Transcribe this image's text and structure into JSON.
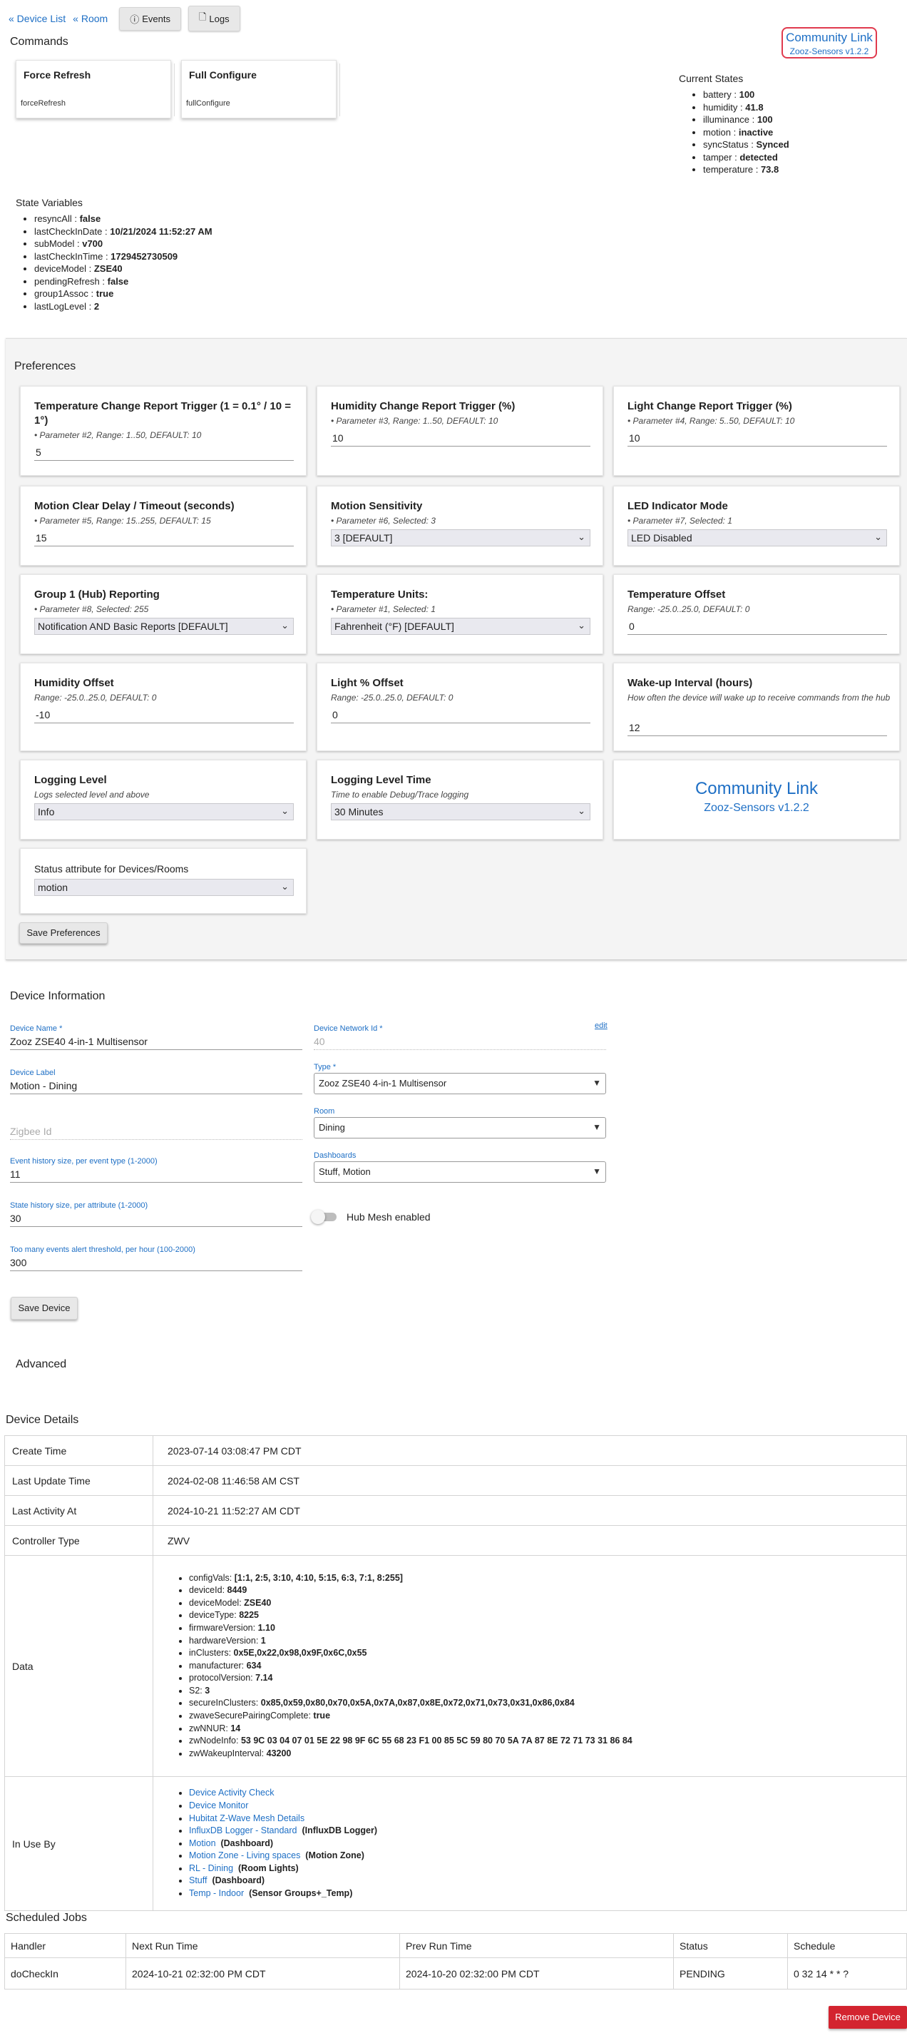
{
  "nav": {
    "device_list": "« Device List",
    "room": "« Room",
    "events": "Events",
    "logs": "Logs"
  },
  "community_top": {
    "title": "Community Link",
    "version": "Zooz-Sensors v1.2.2"
  },
  "commands": {
    "heading": "Commands",
    "items": [
      {
        "title": "Force Refresh",
        "method": "forceRefresh"
      },
      {
        "title": "Full Configure",
        "method": "fullConfigure"
      }
    ]
  },
  "current_states": {
    "heading": "Current States",
    "items": [
      {
        "key": "battery",
        "value": "100"
      },
      {
        "key": "humidity",
        "value": "41.8"
      },
      {
        "key": "illuminance",
        "value": "100"
      },
      {
        "key": "motion",
        "value": "inactive"
      },
      {
        "key": "syncStatus",
        "value": "Synced"
      },
      {
        "key": "tamper",
        "value": "detected"
      },
      {
        "key": "temperature",
        "value": "73.8"
      }
    ]
  },
  "state_variables": {
    "heading": "State Variables",
    "items": [
      {
        "key": "resyncAll",
        "value": "false"
      },
      {
        "key": "lastCheckInDate",
        "value": "10/21/2024 11:52:27 AM"
      },
      {
        "key": "subModel",
        "value": "v700"
      },
      {
        "key": "lastCheckInTime",
        "value": "1729452730509"
      },
      {
        "key": "deviceModel",
        "value": "ZSE40"
      },
      {
        "key": "pendingRefresh",
        "value": "false"
      },
      {
        "key": "group1Assoc",
        "value": "true"
      },
      {
        "key": "lastLogLevel",
        "value": "2"
      }
    ]
  },
  "preferences": {
    "heading": "Preferences",
    "temp_trigger": {
      "title": "Temperature Change Report Trigger (1 = 0.1° / 10 = 1°)",
      "desc": "• Parameter #2, Range: 1..50, DEFAULT: 10",
      "value": "5"
    },
    "humidity_trigger": {
      "title": "Humidity Change Report Trigger (%)",
      "desc": "• Parameter #3, Range: 1..50, DEFAULT: 10",
      "value": "10"
    },
    "light_trigger": {
      "title": "Light Change Report Trigger (%)",
      "desc": "• Parameter #4, Range: 5..50, DEFAULT: 10",
      "value": "10"
    },
    "motion_clear": {
      "title": "Motion Clear Delay / Timeout (seconds)",
      "desc": "• Parameter #5, Range: 15..255, DEFAULT: 15",
      "value": "15"
    },
    "motion_sensitivity": {
      "title": "Motion Sensitivity",
      "desc": "• Parameter #6, Selected: 3",
      "value": "3 [DEFAULT]"
    },
    "led_mode": {
      "title": "LED Indicator Mode",
      "desc": "• Parameter #7, Selected: 1",
      "value": "LED Disabled"
    },
    "group1": {
      "title": "Group 1 (Hub) Reporting",
      "desc": "• Parameter #8, Selected: 255",
      "value": "Notification AND Basic Reports [DEFAULT]"
    },
    "temp_units": {
      "title": "Temperature Units:",
      "desc": "• Parameter #1, Selected: 1",
      "value": "Fahrenheit (°F) [DEFAULT]"
    },
    "temp_offset": {
      "title": "Temperature Offset",
      "desc": "Range: -25.0..25.0, DEFAULT: 0",
      "value": "0"
    },
    "humidity_offset": {
      "title": "Humidity Offset",
      "desc": "Range: -25.0..25.0, DEFAULT: 0",
      "value": "-10"
    },
    "light_offset": {
      "title": "Light % Offset",
      "desc": "Range: -25.0..25.0, DEFAULT: 0",
      "value": "0"
    },
    "wakeup": {
      "title": "Wake-up Interval (hours)",
      "desc": "How often the device will wake up to receive commands from the hub",
      "value": "12"
    },
    "logging_level": {
      "title": "Logging Level",
      "desc": "Logs selected level and above",
      "value": "Info"
    },
    "logging_time": {
      "title": "Logging Level Time",
      "desc": "Time to enable Debug/Trace logging",
      "value": "30 Minutes"
    },
    "community": {
      "title": "Community Link",
      "version": "Zooz-Sensors v1.2.2"
    },
    "status_attr": {
      "title": "Status attribute for Devices/Rooms",
      "value": "motion"
    },
    "save_label": "Save Preferences"
  },
  "device_info": {
    "heading": "Device Information",
    "device_name_label": "Device Name *",
    "device_name": "Zooz ZSE40 4-in-1 Multisensor",
    "network_id_label": "Device Network Id *",
    "network_id": "40",
    "edit_link": "edit",
    "device_label_label": "Device Label",
    "device_label": "Motion - Dining",
    "type_label": "Type *",
    "type_value": "Zooz ZSE40 4-in-1 Multisensor",
    "zigbee_placeholder": "Zigbee Id",
    "room_label": "Room",
    "room_value": "Dining",
    "event_history_label": "Event history size, per event type (1-2000)",
    "event_history": "11",
    "dashboards_label": "Dashboards",
    "dashboards_value": "Stuff, Motion",
    "state_history_label": "State history size, per attribute (1-2000)",
    "state_history": "30",
    "hub_mesh_label": "Hub Mesh enabled",
    "alert_label": "Too many events alert threshold, per hour (100-2000)",
    "alert_threshold": "300",
    "save_label": "Save Device",
    "advanced": "Advanced"
  },
  "device_details": {
    "heading": "Device Details",
    "rows": [
      {
        "key": "Create Time",
        "value": "2023-07-14 03:08:47 PM CDT"
      },
      {
        "key": "Last Update Time",
        "value": "2024-02-08 11:46:58 AM CST"
      },
      {
        "key": "Last Activity At",
        "value": "2024-10-21 11:52:27 AM CDT"
      },
      {
        "key": "Controller Type",
        "value": "ZWV"
      }
    ],
    "data_label": "Data",
    "data": [
      {
        "key": "configVals",
        "value": "[1:1, 2:5, 3:10, 4:10, 5:15, 6:3, 7:1, 8:255]"
      },
      {
        "key": "deviceId",
        "value": "8449"
      },
      {
        "key": "deviceModel",
        "value": "ZSE40"
      },
      {
        "key": "deviceType",
        "value": "8225"
      },
      {
        "key": "firmwareVersion",
        "value": "1.10"
      },
      {
        "key": "hardwareVersion",
        "value": "1"
      },
      {
        "key": "inClusters",
        "value": "0x5E,0x22,0x98,0x9F,0x6C,0x55"
      },
      {
        "key": "manufacturer",
        "value": "634"
      },
      {
        "key": "protocolVersion",
        "value": "7.14"
      },
      {
        "key": "S2",
        "value": "3"
      },
      {
        "key": "secureInClusters",
        "value": "0x85,0x59,0x80,0x70,0x5A,0x7A,0x87,0x8E,0x72,0x71,0x73,0x31,0x86,0x84"
      },
      {
        "key": "zwaveSecurePairingComplete",
        "value": "true"
      },
      {
        "key": "zwNNUR",
        "value": "14"
      },
      {
        "key": "zwNodeInfo",
        "value": "53 9C 03 04 07 01 5E 22 98 9F 6C 55 68 23 F1 00 85 5C 59 80 70 5A 7A 87 8E 72 71 73 31 86 84"
      },
      {
        "key": "zwWakeupInterval",
        "value": "43200"
      }
    ],
    "inuse_label": "In Use By",
    "in_use": [
      {
        "name": "Device Activity Check",
        "type": ""
      },
      {
        "name": "Device Monitor",
        "type": ""
      },
      {
        "name": "Hubitat Z-Wave Mesh Details",
        "type": ""
      },
      {
        "name": "InfluxDB Logger - Standard",
        "type": "(InfluxDB Logger)"
      },
      {
        "name": "Motion",
        "type": "(Dashboard)"
      },
      {
        "name": "Motion Zone - Living spaces",
        "type": "(Motion Zone)"
      },
      {
        "name": "RL - Dining",
        "type": "(Room Lights)"
      },
      {
        "name": "Stuff",
        "type": "(Dashboard)"
      },
      {
        "name": "Temp - Indoor",
        "type": "(Sensor Groups+_Temp)"
      }
    ]
  },
  "scheduled_jobs": {
    "heading": "Scheduled Jobs",
    "columns": [
      "Handler",
      "Next Run Time",
      "Prev Run Time",
      "Status",
      "Schedule"
    ],
    "rows": [
      [
        "doCheckIn",
        "2024-10-21 02:32:00 PM CDT",
        "2024-10-20 02:32:00 PM CDT",
        "PENDING",
        "0 32 14 * * ?"
      ]
    ]
  },
  "remove_label": "Remove Device"
}
